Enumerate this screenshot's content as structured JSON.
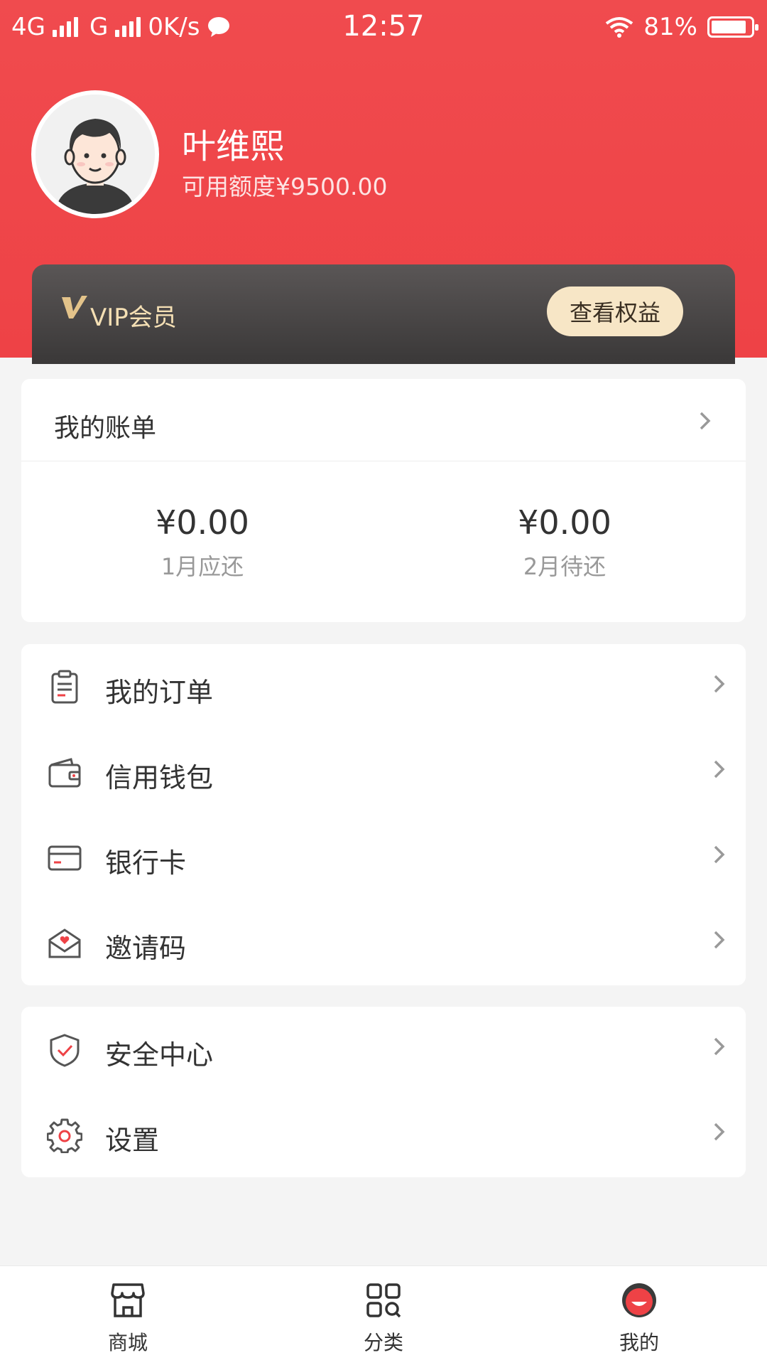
{
  "status_bar": {
    "network_1": "4G",
    "network_2": "G",
    "speed": "0K/s",
    "time": "12:57",
    "battery": "81%"
  },
  "profile": {
    "name": "叶维熙",
    "credit": "可用额度¥9500.00"
  },
  "vip": {
    "label": "VIP会员",
    "button": "查看权益"
  },
  "bill": {
    "title": "我的账单",
    "items": [
      {
        "amount": "¥0.00",
        "label": "1月应还"
      },
      {
        "amount": "¥0.00",
        "label": "2月待还"
      }
    ]
  },
  "menu_main": [
    {
      "label": "我的订单",
      "icon": "order-icon"
    },
    {
      "label": "信用钱包",
      "icon": "wallet-icon"
    },
    {
      "label": "银行卡",
      "icon": "bank-card-icon"
    },
    {
      "label": "邀请码",
      "icon": "invite-envelope-icon"
    }
  ],
  "menu_settings": [
    {
      "label": "安全中心",
      "icon": "shield-icon"
    },
    {
      "label": "设置",
      "icon": "gear-icon"
    }
  ],
  "tabs": [
    {
      "label": "商城",
      "icon": "store-icon"
    },
    {
      "label": "分类",
      "icon": "category-icon"
    },
    {
      "label": "我的",
      "icon": "profile-icon"
    }
  ],
  "colors": {
    "brand_red": "#ee4246",
    "vip_gold": "#f7e6c6",
    "icon_gray": "#555555"
  }
}
